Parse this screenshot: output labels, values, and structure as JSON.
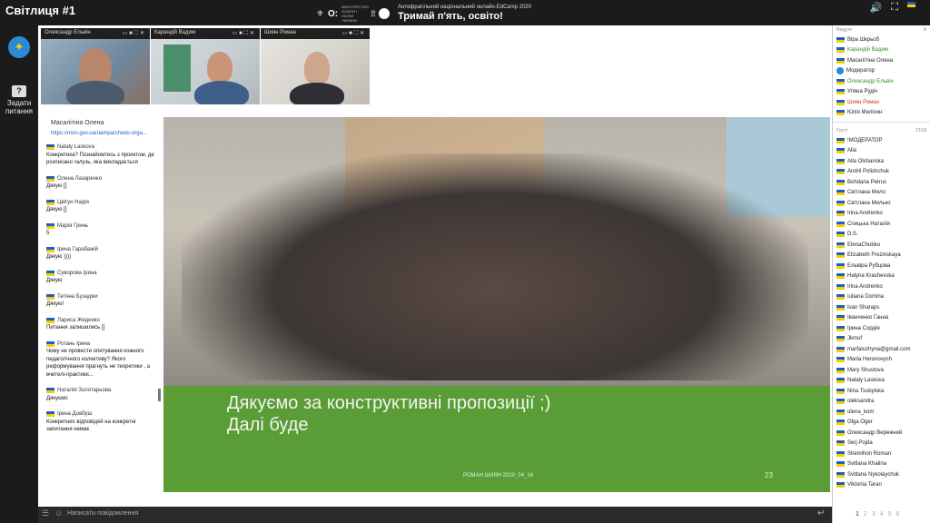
{
  "room_title": "Світлиця #1",
  "banner": {
    "small_text": "Антифрагільний національний онлайн-EdCamp 2020",
    "big_text": "Тримай п'ять, освіто!",
    "logo_caption": "МІНІСТЕРСТВО ОСВІТИ І НАУКИ УКРАЇНИ"
  },
  "left_rail": {
    "ask_label": "Задати питання",
    "ask_icon": "?"
  },
  "videos": [
    {
      "name": "Олександр Ельвін"
    },
    {
      "name": "Карандій Вадим"
    },
    {
      "name": "Шиян Роман"
    }
  ],
  "sharer": {
    "name": "Масалітіна Олена",
    "url": "https://mon.gov.ua/ua/npa/shodo-orga..."
  },
  "chat": [
    {
      "author": "Nataly Laskova",
      "text": "Конкретика? Познайомтесь з проектом, де розписано галузь, яка викладається"
    },
    {
      "author": "Олена Лазаренко",
      "text": "Дякую []"
    },
    {
      "author": "Цвігун Надія",
      "text": "Дякую []"
    },
    {
      "author": "Марія Гринь",
      "text": "5"
    },
    {
      "author": "Ірина Гарабажій",
      "text": "Дякую ))))"
    },
    {
      "author": "Суворова Ірина",
      "text": "Дякую"
    },
    {
      "author": "Тетяна Бузаджи",
      "text": "Дякую!"
    },
    {
      "author": "Лариса Жеденко",
      "text": "Питання залишились []"
    },
    {
      "author": "Ротань Ірина",
      "text": "Чому не провести опитування кожного педагогічного колективу? Якого реформування прагнуть не теоретики , а вчителі-практики..."
    },
    {
      "author": "Наталія Золотарьова",
      "text": "Дякуємо"
    },
    {
      "author": "Ірина Довбуш",
      "text": "Конкретних відповідей на конкретні запитання немає"
    }
  ],
  "chat_input_placeholder": "Написати повідомлення",
  "slide": {
    "line1": "Дякуємо за конструктивні пропозиції ;)",
    "line2": "Далі буде",
    "footer": "РОМАН ШИЯН 2020_04_16",
    "page": "23"
  },
  "leaders_panel": {
    "title": "Ведучі",
    "count": "8",
    "people": [
      {
        "name": "Віра Шкрьоб",
        "color": "normal"
      },
      {
        "name": "Карандій Вадим",
        "color": "green"
      },
      {
        "name": "Масалітіна Олена",
        "color": "normal"
      },
      {
        "name": "Модератор",
        "color": "normal",
        "icon": "globe"
      },
      {
        "name": "Олександр Ельвін",
        "color": "green"
      },
      {
        "name": "Уляна Рудіч",
        "color": "normal"
      },
      {
        "name": "Шиян Роман",
        "color": "red"
      },
      {
        "name": "Юлія Меліхин",
        "color": "normal"
      }
    ]
  },
  "guests_panel": {
    "title": "Гості",
    "count": "2118",
    "people": [
      "!МОДЕРАТОР",
      "Alla",
      "Alla Olshanska",
      "Andrii Polishchuk",
      "Bohdana Petrus",
      "Світлана Мило",
      "Світлана Милько",
      "Irina Andrenko",
      "Спицька Наталія",
      "D.S.",
      "ElenaChubko",
      "Elizabeth Frezinskaya",
      "Ельвіра Рубцова",
      "Halyna Krashevska",
      "Irina Andrenko",
      "Iuliana Domina",
      "Ivan Sharaps",
      "Іванченко Ганна",
      "Ірина Сордія",
      "Jkmuf",
      "marfaluzhyna@gmail.com",
      "Marta Heronovych",
      "Mary Shustova",
      "Nataly Laskova",
      "Nina Tsubylska",
      "oleksandra",
      "olena_kom",
      "Olga Oger",
      "Олександр Вережний",
      "Serj Pojda",
      "Shemihon Roman",
      "Svitlana Khalina",
      "Svitlana Nykolaychuk",
      "Viktoriia Taran"
    ]
  },
  "pagination": [
    "1",
    "2",
    "3",
    "4",
    "5",
    "6"
  ],
  "colors": {
    "accent_green": "#5a9c36",
    "leader_green": "#3c8f2c",
    "leader_red": "#d83020"
  }
}
